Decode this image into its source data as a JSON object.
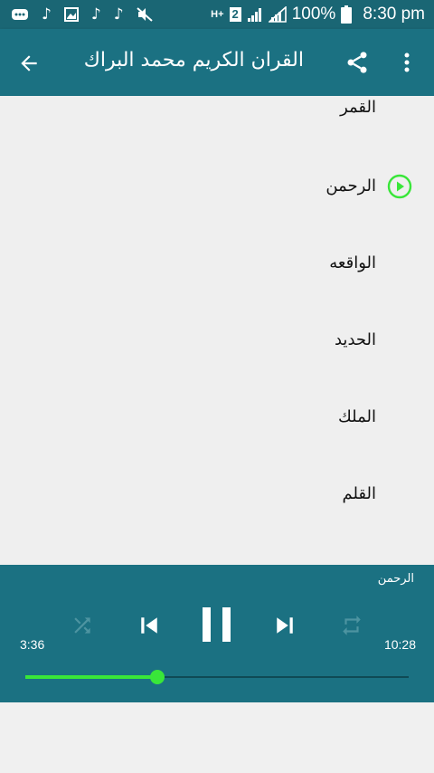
{
  "status_bar": {
    "battery_text": "100%",
    "time": "8:30 pm",
    "sim_label": "2",
    "network_label": "H+"
  },
  "app_bar": {
    "title": "القران الكريم محمد البراك",
    "back_icon": "arrow-back-icon",
    "share_icon": "share-icon",
    "menu_icon": "more-vert-icon"
  },
  "tracks": [
    {
      "label": "القمر",
      "playing": false
    },
    {
      "label": "الرحمن",
      "playing": true
    },
    {
      "label": "الواقعه",
      "playing": false
    },
    {
      "label": "الحديد",
      "playing": false
    },
    {
      "label": "الملك",
      "playing": false
    },
    {
      "label": "القلم",
      "playing": false
    }
  ],
  "player": {
    "now_playing": "الرحمن",
    "current_time": "3:36",
    "total_time": "10:28",
    "progress": 0.345,
    "accent_color": "#39e639",
    "bar_color": "#1b7182"
  }
}
